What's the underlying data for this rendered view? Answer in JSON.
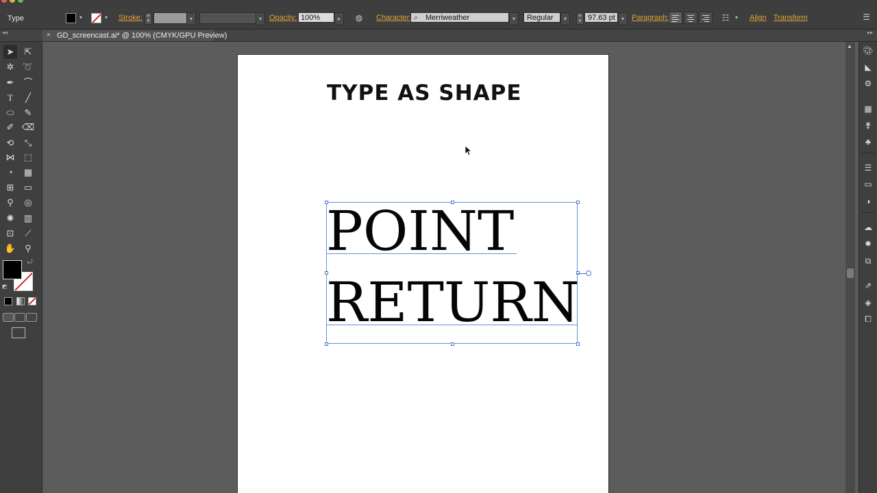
{
  "control_bar": {
    "tool_name": "Type",
    "stroke_label": "Stroke:",
    "opacity_label": "Opacity:",
    "opacity_value": "100%",
    "character_label": "Character:",
    "font_family": "Merriweather",
    "font_style": "Regular",
    "font_size": "97.63 pt",
    "paragraph_label": "Paragraph:",
    "align_label": "Align",
    "transform_label": "Transform"
  },
  "document_tab": {
    "title": "GD_screencast.ai* @ 100% (CMYK/GPU Preview)",
    "close_glyph": "×"
  },
  "artboard": {
    "heading": "TYPE AS SHAPE",
    "lines": [
      "POINT",
      "RETURN"
    ]
  },
  "colors": {
    "ui_dark": "#3e3e3e",
    "canvas": "#5c5c5c",
    "label_accent": "#e4a23a",
    "selection": "#4a74c9"
  }
}
